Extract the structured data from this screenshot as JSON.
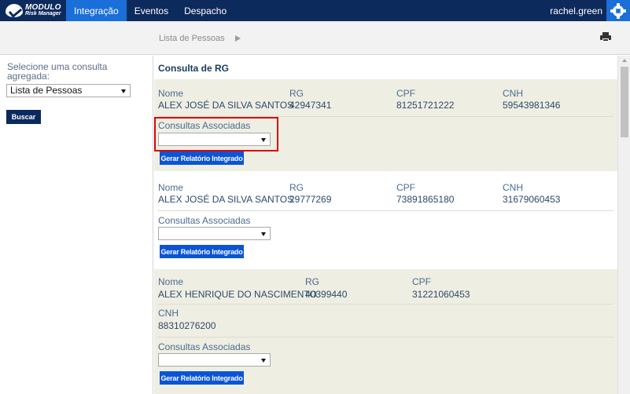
{
  "app": {
    "logo_line1": "MODULO",
    "logo_line2": "Risk Manager"
  },
  "nav": {
    "items": [
      "Integração",
      "Eventos",
      "Despacho"
    ],
    "active": "Integração"
  },
  "user": {
    "name": "rachel.green"
  },
  "breadcrumb": {
    "label": "Lista de Pessoas"
  },
  "sidebar": {
    "label": "Selecione uma consulta agregada:",
    "select_value": "Lista de Pessoas",
    "search_button": "Buscar"
  },
  "main": {
    "title": "Consulta de RG",
    "labels": {
      "nome": "Nome",
      "rg": "RG",
      "cpf": "CPF",
      "cnh": "CNH",
      "associadas": "Consultas Associadas",
      "report_button": "Gerar Relatório Integrado"
    },
    "records": [
      {
        "nome": "ALEX JOSÉ DA SILVA SANTOS",
        "rg": "42947341",
        "cpf": "81251721222",
        "cnh": "59543981346",
        "associadas_value": ""
      },
      {
        "nome": "ALEX JOSÉ DA SILVA SANTOS",
        "rg": "29777269",
        "cpf": "73891865180",
        "cnh": "31679060453",
        "associadas_value": ""
      },
      {
        "nome": "ALEX HENRIQUE DO NASCIMENTO",
        "rg": "40399440",
        "cpf": "31221060453",
        "cnh": "88310276200",
        "associadas_value": ""
      }
    ]
  },
  "colors": {
    "nav_bg": "#0d2a5c",
    "accent": "#1a6fd8",
    "button": "#0a55d6",
    "record_shade": "#efeee3",
    "highlight": "#e00000"
  },
  "icons": {
    "logo": "modulo-logo-icon",
    "settings": "gear-icon",
    "print": "printer-icon",
    "crumb": "arrow-right-icon"
  }
}
